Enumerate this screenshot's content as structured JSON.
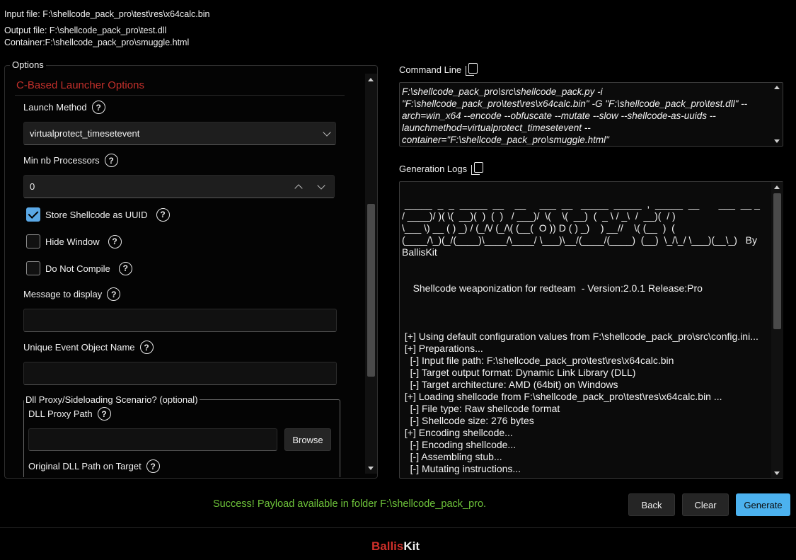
{
  "header": {
    "input_file": "Input file: F:\\shellcode_pack_pro\\test\\res\\x64calc.bin",
    "output_file": "Output file: F:\\shellcode_pack_pro\\test.dll",
    "container": "Container:F:\\shellcode_pack_pro\\smuggle.html"
  },
  "options": {
    "legend": "Options",
    "section_title": "C-Based Launcher Options",
    "launch_method_label": "Launch Method",
    "launch_method_value": "virtualprotect_timesetevent",
    "min_processors_label": "Min nb Processors",
    "min_processors_value": "0",
    "store_uuid_label": "Store Shellcode as UUID",
    "store_uuid_checked": true,
    "hide_window_label": "Hide Window",
    "hide_window_checked": false,
    "do_not_compile_label": "Do Not Compile",
    "do_not_compile_checked": false,
    "message_label": "Message to display",
    "message_value": "",
    "event_name_label": "Unique Event Object Name",
    "event_name_value": "",
    "dll_group_legend": "Dll Proxy/Sideloading Scenario? (optional)",
    "dll_proxy_path_label": "DLL Proxy Path",
    "dll_proxy_path_value": "",
    "browse_label": "Browse",
    "original_dll_label": "Original DLL Path on Target"
  },
  "command_line": {
    "label": "Command Line",
    "text": "F:\\shellcode_pack_pro\\src\\shellcode_pack.py -i \"F:\\shellcode_pack_pro\\test\\res\\x64calc.bin\" -G \"F:\\shellcode_pack_pro\\test.dll\" --arch=win_x64 --encode --obfuscate --mutate --slow --shellcode-as-uuids --launchmethod=virtualprotect_timesetevent --container=\"F:\\shellcode_pack_pro\\smuggle.html\""
  },
  "generation_logs": {
    "label": "Generation Logs",
    "text": "\n _____  _  _  _____  __    __     ___  __   _____  _____  ,  _____  __       ___  __ _\n/ ____)/ )( \\(  __)(  )  (  )   / ___)/  \\(    \\(  __)  (  _ \\ / _\\  /  __)(  / )\n\\___ \\) __ ( ) _) / (_/\\/ (_/\\( (__(  O )) D ( ) _)    ) __//    \\( (__  )  (\n(____/\\_)(_/(____)\\____/\\____/ \\___)\\__/(____/(____)  (__)  \\_/\\_/ \\___)(__\\_)   By BallisKit\n\n\n    Shellcode weaponization for redteam  - Version:2.0.1 Release:Pro\n\n\n\n [+] Using default configuration values from F:\\shellcode_pack_pro\\src\\config.ini...\n [+] Preparations...\n   [-] Input file path: F:\\shellcode_pack_pro\\test\\res\\x64calc.bin\n   [-] Target output format: Dynamic Link Library (DLL)\n   [-] Target architecture: AMD (64bit) on Windows\n [+] Loading shellcode from F:\\shellcode_pack_pro\\test\\res\\x64calc.bin ...\n   [-] File type: Raw shellcode format\n   [-] Shellcode size: 276 bytes\n [+] Encoding shellcode...\n   [-] Encoding shellcode...\n   [-] Assembling stub...\n   [-] Mutating instructions..."
  },
  "status": {
    "success": "Success! Payload available in folder F:\\shellcode_pack_pro."
  },
  "buttons": {
    "back": "Back",
    "clear": "Clear",
    "generate": "Generate"
  },
  "footer": {
    "brand_part1": "Ballis",
    "brand_part2": "Kit"
  },
  "colors": {
    "accent": "#4cb2ef",
    "brand_red": "#d0302a",
    "success": "#6ec43a",
    "section_title": "#c4302b"
  }
}
